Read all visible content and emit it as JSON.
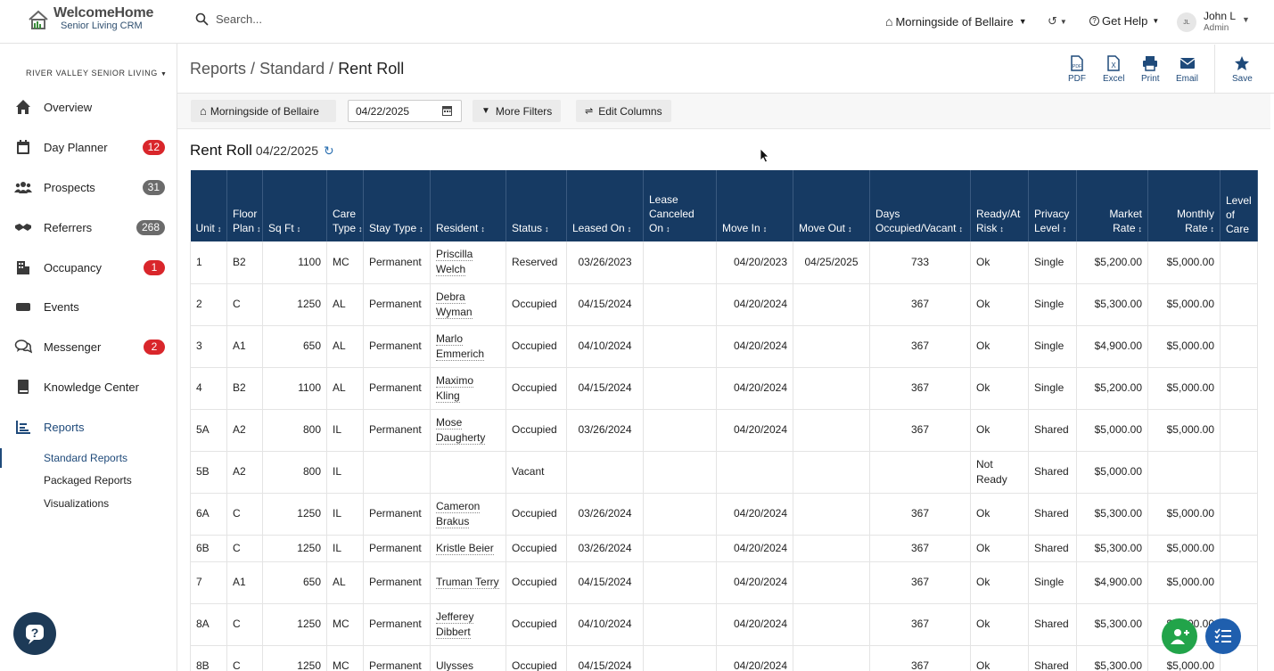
{
  "brand": {
    "name": "WelcomeHome",
    "sub": "Senior Living CRM"
  },
  "search": {
    "placeholder": "Search..."
  },
  "topbar": {
    "community": "Morningside of Bellaire",
    "help": "Get Help",
    "user_initials": "JL",
    "user_name": "John L",
    "user_role": "Admin"
  },
  "sidebar": {
    "org": "RIVER VALLEY SENIOR LIVING",
    "items": [
      {
        "label": "Overview",
        "icon": "home-icon"
      },
      {
        "label": "Day Planner",
        "icon": "calendar-icon",
        "badge": "12"
      },
      {
        "label": "Prospects",
        "icon": "people-icon",
        "badge": "31"
      },
      {
        "label": "Referrers",
        "icon": "handshake-icon",
        "badge": "268"
      },
      {
        "label": "Occupancy",
        "icon": "building-icon",
        "badge": "1"
      },
      {
        "label": "Events",
        "icon": "ticket-icon"
      },
      {
        "label": "Messenger",
        "icon": "chat-icon",
        "badge": "2"
      },
      {
        "label": "Knowledge Center",
        "icon": "book-icon"
      },
      {
        "label": "Reports",
        "icon": "chart-icon"
      }
    ],
    "subitems": [
      "Standard Reports",
      "Packaged Reports",
      "Visualizations"
    ]
  },
  "breadcrumb": {
    "a": "Reports",
    "sep": "/",
    "b": "Standard",
    "c": "Rent Roll"
  },
  "actions": {
    "pdf": "PDF",
    "excel": "Excel",
    "print": "Print",
    "email": "Email",
    "save": "Save"
  },
  "filters": {
    "community": "Morningside of Bellaire",
    "date": "04/22/2025",
    "more": "More Filters",
    "edit": "Edit Columns"
  },
  "report": {
    "title": "Rent Roll",
    "date": "04/22/2025"
  },
  "colors": {
    "header": "#163a63",
    "badge_red": "#d9262b",
    "fab_green": "#22a44a",
    "fab_blue": "#1f5fae"
  },
  "table": {
    "columns": [
      "Unit",
      "Floor Plan",
      "Sq Ft",
      "Care Type",
      "Stay Type",
      "Resident",
      "Status",
      "Leased On",
      "Lease Canceled On",
      "Move In",
      "Move Out",
      "Days Occupied/Vacant",
      "Ready/At Risk",
      "Privacy Level",
      "Market Rate",
      "Monthly Rate",
      "Level of Care"
    ],
    "rows": [
      [
        "1",
        "B2",
        "1100",
        "MC",
        "Permanent",
        "Priscilla Welch",
        "Reserved",
        "03/26/2023",
        "",
        "04/20/2023",
        "04/25/2025",
        "733",
        "Ok",
        "Single",
        "$5,200.00",
        "$5,000.00",
        ""
      ],
      [
        "2",
        "C",
        "1250",
        "AL",
        "Permanent",
        "Debra Wyman",
        "Occupied",
        "04/15/2024",
        "",
        "04/20/2024",
        "",
        "367",
        "Ok",
        "Single",
        "$5,300.00",
        "$5,000.00",
        ""
      ],
      [
        "3",
        "A1",
        "650",
        "AL",
        "Permanent",
        "Marlo Emmerich",
        "Occupied",
        "04/10/2024",
        "",
        "04/20/2024",
        "",
        "367",
        "Ok",
        "Single",
        "$4,900.00",
        "$5,000.00",
        ""
      ],
      [
        "4",
        "B2",
        "1100",
        "AL",
        "Permanent",
        "Maximo Kling",
        "Occupied",
        "04/15/2024",
        "",
        "04/20/2024",
        "",
        "367",
        "Ok",
        "Single",
        "$5,200.00",
        "$5,000.00",
        ""
      ],
      [
        "5A",
        "A2",
        "800",
        "IL",
        "Permanent",
        "Mose Daugherty",
        "Occupied",
        "03/26/2024",
        "",
        "04/20/2024",
        "",
        "367",
        "Ok",
        "Shared",
        "$5,000.00",
        "$5,000.00",
        ""
      ],
      [
        "5B",
        "A2",
        "800",
        "IL",
        "",
        "",
        "Vacant",
        "",
        "",
        "",
        "",
        "",
        "Not Ready",
        "Shared",
        "$5,000.00",
        "",
        ""
      ],
      [
        "6A",
        "C",
        "1250",
        "IL",
        "Permanent",
        "Cameron Brakus",
        "Occupied",
        "03/26/2024",
        "",
        "04/20/2024",
        "",
        "367",
        "Ok",
        "Shared",
        "$5,300.00",
        "$5,000.00",
        ""
      ],
      [
        "6B",
        "C",
        "1250",
        "IL",
        "Permanent",
        "Kristle Beier",
        "Occupied",
        "03/26/2024",
        "",
        "04/20/2024",
        "",
        "367",
        "Ok",
        "Shared",
        "$5,300.00",
        "$5,000.00",
        ""
      ],
      [
        "7",
        "A1",
        "650",
        "AL",
        "Permanent",
        "Truman Terry",
        "Occupied",
        "04/15/2024",
        "",
        "04/20/2024",
        "",
        "367",
        "Ok",
        "Single",
        "$4,900.00",
        "$5,000.00",
        ""
      ],
      [
        "8A",
        "C",
        "1250",
        "MC",
        "Permanent",
        "Jefferey Dibbert",
        "Occupied",
        "04/10/2024",
        "",
        "04/20/2024",
        "",
        "367",
        "Ok",
        "Shared",
        "$5,300.00",
        "$5,000.00",
        ""
      ],
      [
        "8B",
        "C",
        "1250",
        "MC",
        "Permanent",
        "Ulysses",
        "Occupied",
        "04/15/2024",
        "",
        "04/20/2024",
        "",
        "367",
        "Ok",
        "Shared",
        "$5,300.00",
        "$5,000.00",
        ""
      ]
    ]
  }
}
